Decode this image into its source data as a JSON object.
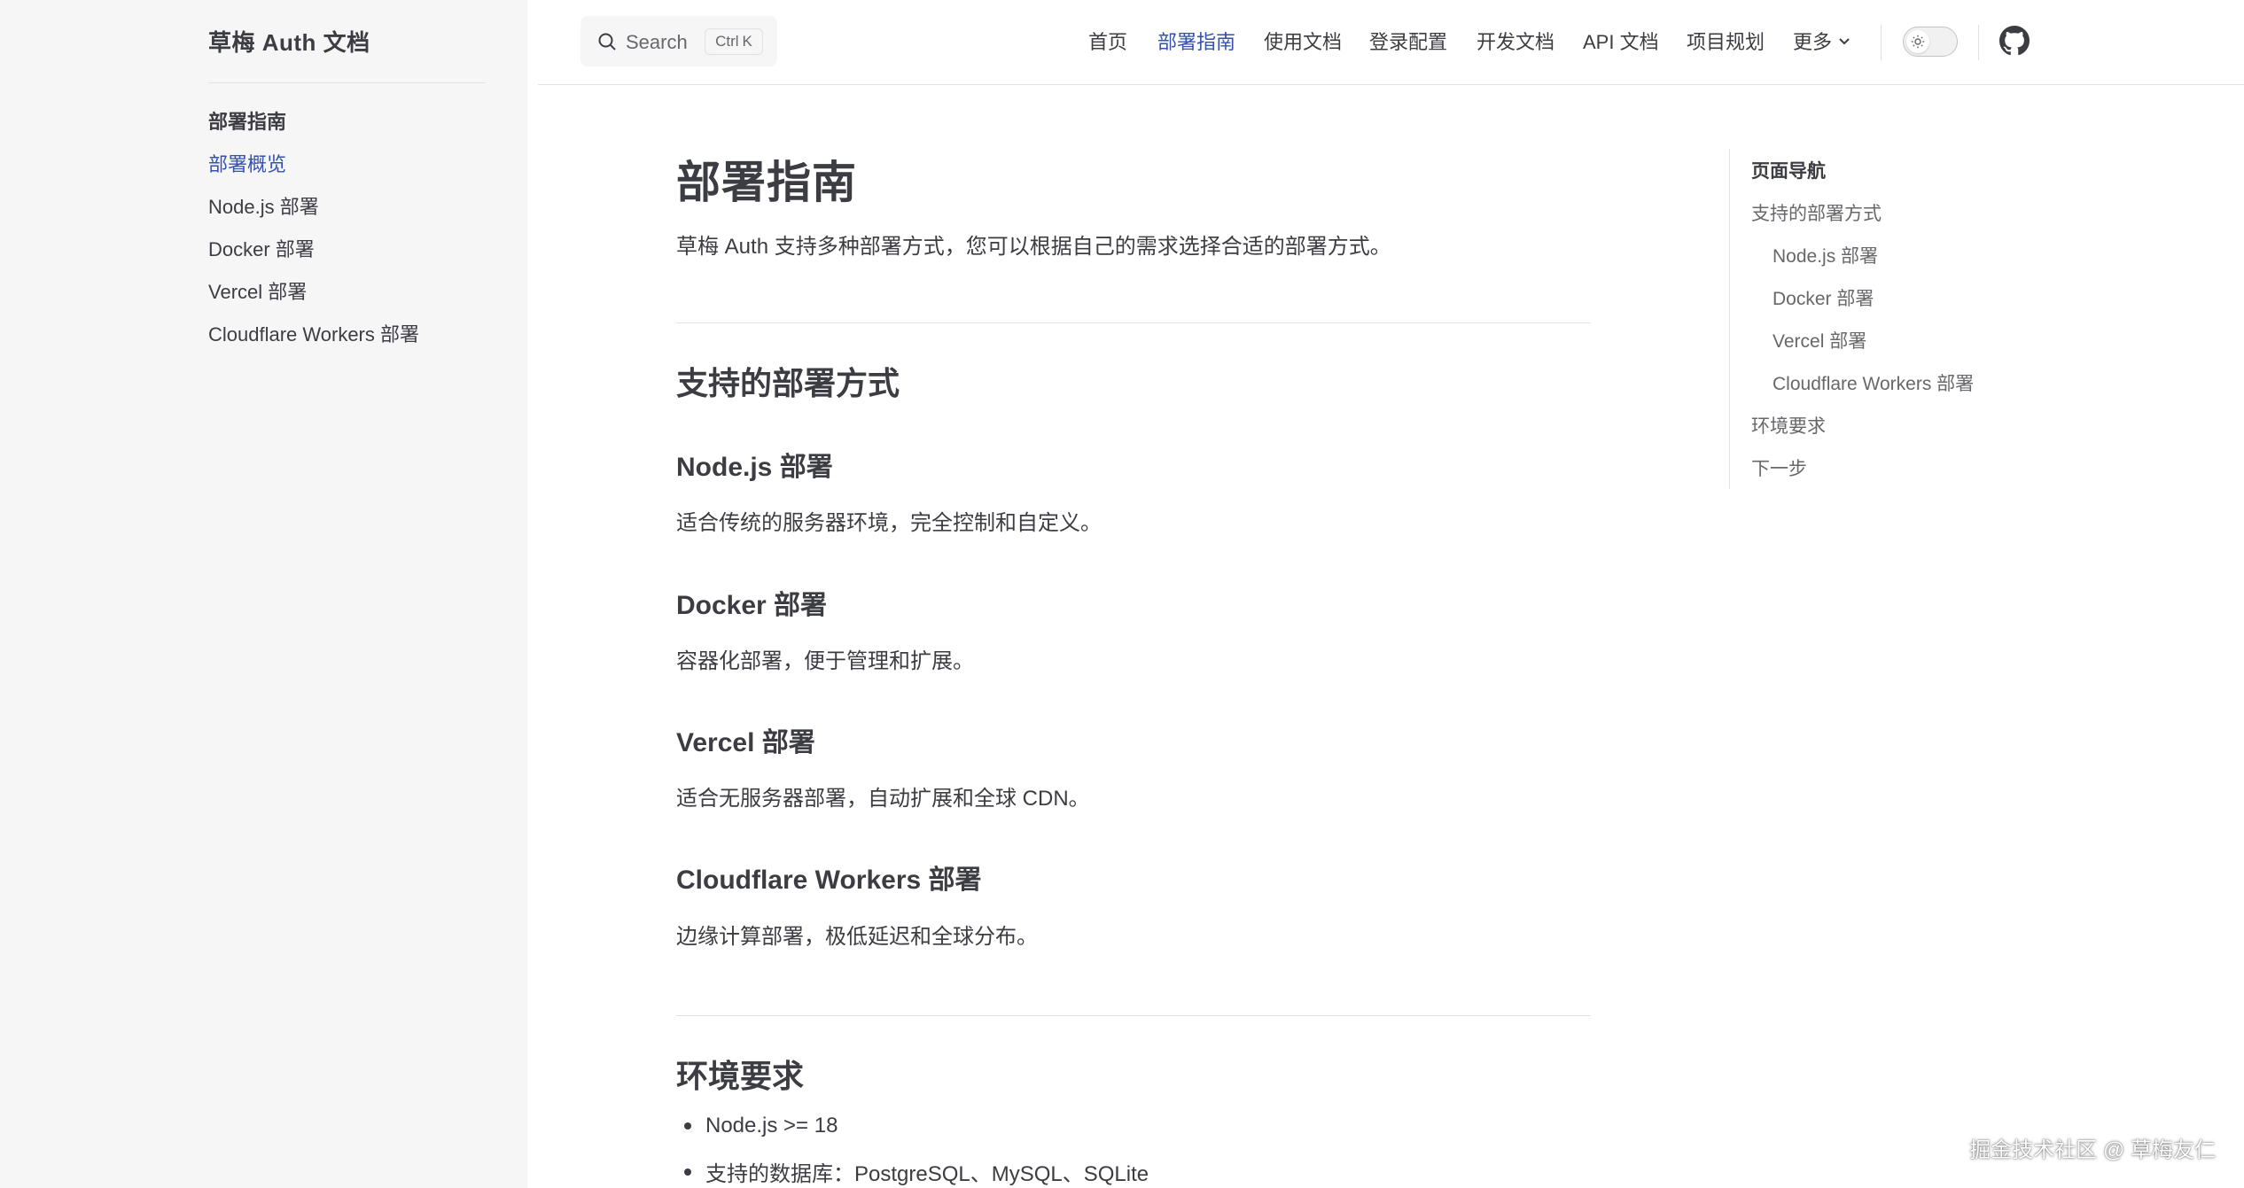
{
  "sidebar": {
    "site_title": "草梅 Auth 文档",
    "group_title": "部署指南",
    "items": [
      {
        "label": "部署概览",
        "active": true
      },
      {
        "label": "Node.js 部署"
      },
      {
        "label": "Docker 部署"
      },
      {
        "label": "Vercel 部署"
      },
      {
        "label": "Cloudflare Workers 部署"
      }
    ]
  },
  "navbar": {
    "search_label": "Search",
    "search_kbd_ctrl": "Ctrl",
    "search_kbd_key": "K",
    "links": [
      {
        "label": "首页"
      },
      {
        "label": "部署指南",
        "active": true
      },
      {
        "label": "使用文档"
      },
      {
        "label": "登录配置"
      },
      {
        "label": "开发文档"
      },
      {
        "label": "API 文档"
      },
      {
        "label": "项目规划"
      },
      {
        "label": "更多"
      }
    ]
  },
  "content": {
    "title": "部署指南",
    "lead": "草梅 Auth 支持多种部署方式，您可以根据自己的需求选择合适的部署方式。",
    "section1_title": "支持的部署方式",
    "methods": [
      {
        "title": "Node.js 部署",
        "desc": "适合传统的服务器环境，完全控制和自定义。"
      },
      {
        "title": "Docker 部署",
        "desc": "容器化部署，便于管理和扩展。"
      },
      {
        "title": "Vercel 部署",
        "desc": "适合无服务器部署，自动扩展和全球 CDN。"
      },
      {
        "title": "Cloudflare Workers 部署",
        "desc": "边缘计算部署，极低延迟和全球分布。"
      }
    ],
    "section2_title": "环境要求",
    "requirements": [
      "Node.js >= 18",
      "支持的数据库：PostgreSQL、MySQL、SQLite"
    ]
  },
  "outline": {
    "title": "页面导航",
    "items": [
      {
        "label": "支持的部署方式",
        "level": 1
      },
      {
        "label": "Node.js 部署",
        "level": 2
      },
      {
        "label": "Docker 部署",
        "level": 2
      },
      {
        "label": "Vercel 部署",
        "level": 2
      },
      {
        "label": "Cloudflare Workers 部署",
        "level": 2
      },
      {
        "label": "环境要求",
        "level": 1
      },
      {
        "label": "下一步",
        "level": 1
      }
    ]
  },
  "watermark": "掘金技术社区 @ 草梅友仁",
  "colors": {
    "brand": "#3451b2",
    "text": "#3c3c43",
    "muted": "#67676c",
    "sidebar_bg": "#f6f6f7",
    "divider": "#e2e2e3"
  }
}
